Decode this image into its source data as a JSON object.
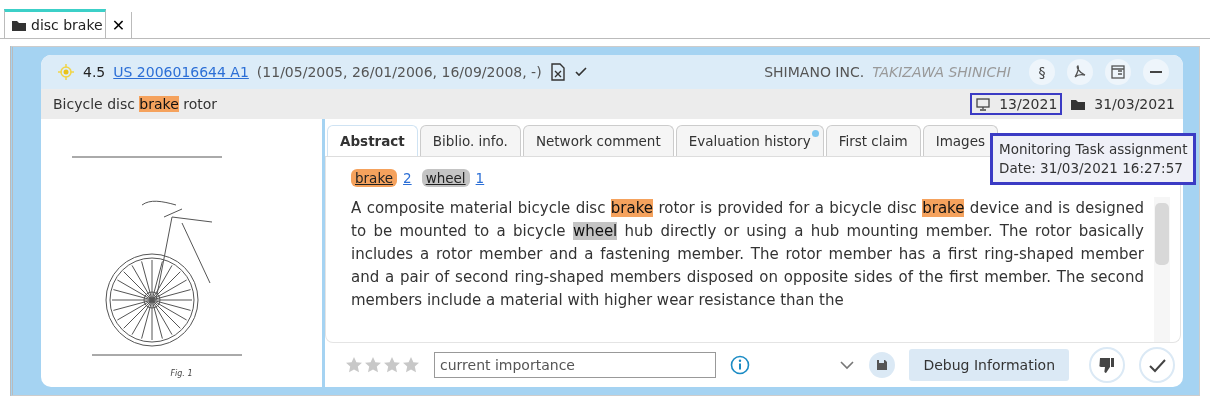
{
  "doc_tab": {
    "label": "disc brake",
    "close": "✕",
    "selected": true
  },
  "header": {
    "score": "4.5",
    "number": "US 2006016644 A1",
    "dates": "(11/05/2005, 26/01/2006, 16/09/2008, -)",
    "applicant": "SHIMANO INC.",
    "inventor": "TAKIZAWA SHINICHI",
    "section_button": "§"
  },
  "keywords": [
    {
      "text": "brake",
      "count": "2",
      "color": "#f5a25d"
    },
    {
      "text": "wheel",
      "count": "1",
      "color": "#c4c4c4"
    }
  ],
  "title": [
    {
      "text": "Bicycle disc "
    },
    {
      "text": "brake",
      "color": "#f5a25d"
    },
    {
      "text": " rotor"
    }
  ],
  "monitoring": {
    "week": "13/2021",
    "highlighted": true
  },
  "folder_date": "31/03/2021",
  "tooltip": {
    "lines": [
      "Monitoring Task assignment",
      "Date: 31/03/2021 16:27:57"
    ],
    "highlighted": true
  },
  "figure_caption": "Fig. 1",
  "tabs": [
    {
      "label": "Abstract",
      "selected": true,
      "has_update": false
    },
    {
      "label": "Biblio. info.",
      "selected": false,
      "has_update": false
    },
    {
      "label": "Network comment",
      "selected": false,
      "has_update": false
    },
    {
      "label": "Evaluation history",
      "selected": false,
      "has_update": true
    },
    {
      "label": "First claim",
      "selected": false,
      "has_update": false
    },
    {
      "label": "Images",
      "selected": false,
      "has_update": false
    }
  ],
  "abstract": [
    {
      "text": "A composite material bicycle disc "
    },
    {
      "text": "brake",
      "color": "#f5a25d"
    },
    {
      "text": " rotor is provided for a bicycle disc "
    },
    {
      "text": "brake",
      "color": "#f5a25d"
    },
    {
      "text": " device and is designed to be mounted to a bicycle "
    },
    {
      "text": "wheel",
      "color": "#c4c4c4"
    },
    {
      "text": " hub directly or using a hub mounting member. The rotor basically includes a rotor member and a fastening member. The rotor member has a first ring-shaped member and a pair of second ring-shaped members disposed on opposite sides of the first member. The second members include a material with higher wear resistance than the"
    }
  ],
  "footer": {
    "stars": 0,
    "importance": {
      "placeholder": "current importance"
    },
    "debug_button": "Debug Information"
  }
}
